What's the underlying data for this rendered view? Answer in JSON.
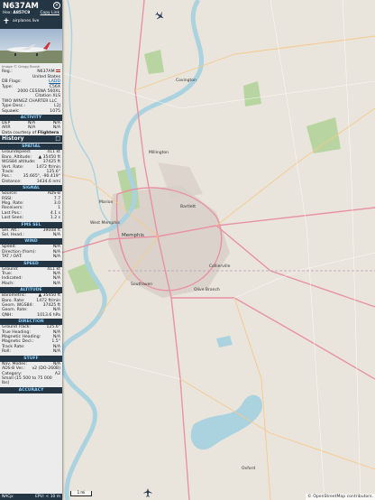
{
  "header": {
    "callsign": "N637AM",
    "hex_label": "Hex:",
    "hex": "A857C9",
    "copy_link": "Copy Link",
    "site": "airplanes.live"
  },
  "photo": {
    "credit": "Image © Gregg Roush"
  },
  "aircraft": {
    "reg_label": "Reg.:",
    "reg": "N637AM",
    "country": "United States",
    "db_flags_label": "DB Flags:",
    "db_flags": "LADD",
    "type_label": "Type:",
    "type": "C56X",
    "type_full": "2000 CESSNA 560XL Citation XLS",
    "owner": "TWO WINGZ CHARTER LLC",
    "type_desc_label": "Type Desc.:",
    "type_desc": "L2J",
    "squawk_label": "Squawk:",
    "squawk": "1075"
  },
  "activity": {
    "title": "ACTIVITY",
    "dep_label": "DEP",
    "dep": "N/A",
    "dep_time": "N/A",
    "arr_label": "ARR",
    "arr": "N/A",
    "arr_time": "N/A",
    "courtesy": "Data courtesy of",
    "courtesy_src": "Flightera"
  },
  "history": {
    "label": "History",
    "toggle": "□"
  },
  "spatial": {
    "title": "SPATIAL",
    "rows": [
      {
        "k": "Groundspeed:",
        "v": "411 kt"
      },
      {
        "k": "Baro. Altitude:",
        "v": "▲ 35450 ft"
      },
      {
        "k": "WGS84 altitude:",
        "v": "37425 ft"
      },
      {
        "k": "Vert. Rate:",
        "v": "1472 ft/min"
      },
      {
        "k": "Track:",
        "v": "125.6°"
      },
      {
        "k": "Pos.:",
        "v": "35.665°, -90.419°"
      },
      {
        "k": "Distance:",
        "v": "3434.6 nmi"
      }
    ]
  },
  "signal": {
    "title": "SIGNAL",
    "rows": [
      {
        "k": "Source:",
        "v": "ADS-B"
      },
      {
        "k": "RSSI:",
        "v": "7.7"
      },
      {
        "k": "Msg. Rate:",
        "v": "3.0"
      },
      {
        "k": "Receivers:",
        "v": "1"
      },
      {
        "k": "Last Pos.:",
        "v": "4.1 s"
      },
      {
        "k": "Last Seen:",
        "v": "1.2 s"
      }
    ]
  },
  "fms": {
    "title": "FMS SEL",
    "rows": [
      {
        "k": "Sel. Alt.:",
        "v": "39008 ft"
      },
      {
        "k": "Sel. Head.:",
        "v": "N/A"
      }
    ]
  },
  "wind": {
    "title": "WIND",
    "rows": [
      {
        "k": "Speed:",
        "v": "N/A"
      },
      {
        "k": "Direction (from):",
        "v": "N/A"
      },
      {
        "k": "TAT / OAT:",
        "v": "N/A"
      }
    ]
  },
  "speed": {
    "title": "SPEED",
    "rows": [
      {
        "k": "Ground:",
        "v": "411 kt"
      },
      {
        "k": "True:",
        "v": "N/A"
      },
      {
        "k": "Indicated:",
        "v": "N/A"
      },
      {
        "k": "Mach:",
        "v": "N/A"
      }
    ]
  },
  "altitude": {
    "title": "ALTITUDE",
    "rows": [
      {
        "k": "Barometric:",
        "v": "▲ 35450 ft"
      },
      {
        "k": "Baro. Rate:",
        "v": "1472 ft/min"
      },
      {
        "k": "Geom. WGS84:",
        "v": "37425 ft"
      },
      {
        "k": "Geom. Rate:",
        "v": "N/A"
      },
      {
        "k": "QNH:",
        "v": "1013.6 hPa"
      }
    ]
  },
  "direction": {
    "title": "DIRECTION",
    "rows": [
      {
        "k": "Ground Track:",
        "v": "125.6°"
      },
      {
        "k": "True Heading:",
        "v": "N/A"
      },
      {
        "k": "Magnetic Heading:",
        "v": "N/A"
      },
      {
        "k": "Magnetic Decl.:",
        "v": "1.5°"
      },
      {
        "k": "Track Rate:",
        "v": "N/A"
      },
      {
        "k": "Roll:",
        "v": "N/A"
      }
    ]
  },
  "stuff": {
    "title": "STUFF",
    "rows": [
      {
        "k": "Nav. Modes:",
        "v": "N/A"
      },
      {
        "k": "ADS-B Ver.:",
        "v": "v2 (DO-260B)"
      },
      {
        "k": "Category:",
        "v": "A2"
      }
    ],
    "category_desc": "Small (15 500 to 75 000 lbs)"
  },
  "accuracy": {
    "title": "ACCURACY",
    "nacp_label": "NACp:",
    "epu": "EPU: < 10 m"
  },
  "map": {
    "scale": "1 mi",
    "attribution": "© OpenStreetMap contributors.",
    "cities": [
      "Memphis",
      "Collierville",
      "Southaven",
      "Bartlett",
      "Millington",
      "Oxford",
      "Olive Branch",
      "West Memphis",
      "Covington",
      "Marion"
    ],
    "colors": {
      "land": "#e9e5dc",
      "water": "#aad3df",
      "forest": "#b7d4a1",
      "motorway": "#e892a2",
      "urban": "#d9d0c9",
      "aircraft": "#2b3a4d"
    }
  }
}
